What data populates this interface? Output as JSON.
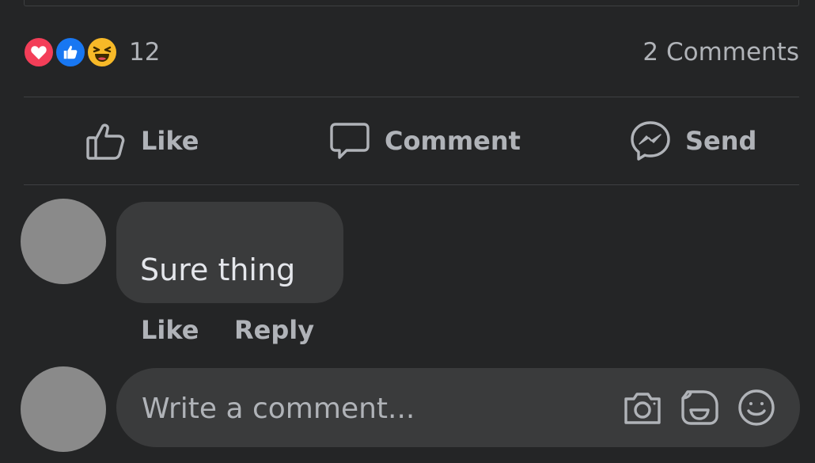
{
  "post": {
    "reactions": {
      "icons": [
        "love-icon",
        "like-icon",
        "haha-icon"
      ],
      "count": "12"
    },
    "comments_count": "2 Comments",
    "actions": {
      "like_label": "Like",
      "comment_label": "Comment",
      "send_label": "Send"
    }
  },
  "comments": [
    {
      "text": "Sure thing",
      "like_label": "Like",
      "reply_label": "Reply"
    }
  ],
  "composer": {
    "placeholder": "Write a comment...",
    "icons": [
      "camera-icon",
      "gif-sticker-icon",
      "emoji-icon"
    ]
  },
  "colors": {
    "background": "#242526",
    "bubble": "#3a3b3c",
    "secondary_text": "#b0b3b8",
    "love": "#f33e58",
    "like": "#1877f2",
    "haha": "#f7b928"
  }
}
